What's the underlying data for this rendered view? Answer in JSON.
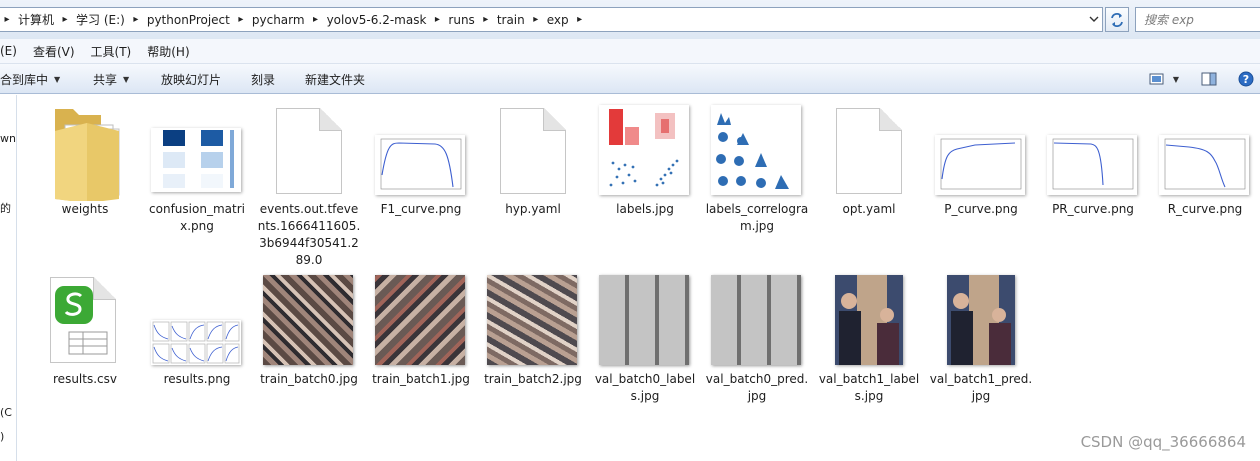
{
  "breadcrumbs": [
    "计算机",
    "学习 (E:)",
    "pythonProject",
    "pycharm",
    "yolov5-6.2-mask",
    "runs",
    "train",
    "exp"
  ],
  "search": {
    "placeholder": "搜索 exp"
  },
  "menu": [
    "(E)",
    "查看(V)",
    "工具(T)",
    "帮助(H)"
  ],
  "commands": {
    "include": "合到库中",
    "share": "共享",
    "slideshow": "放映幻灯片",
    "burn": "刻录",
    "new_folder": "新建文件夹"
  },
  "nav_fragments": [
    "wn",
    "的",
    "(C",
    ")"
  ],
  "files_row1": [
    {
      "name": "weights",
      "icon": "folder-icon"
    },
    {
      "name": "confusion_matrix.png",
      "icon": "image-icon"
    },
    {
      "name": "events.out.tfevents.1666411605.3b6944f30541.289.0",
      "icon": "file-icon"
    },
    {
      "name": "F1_curve.png",
      "icon": "image-icon"
    },
    {
      "name": "hyp.yaml",
      "icon": "file-icon"
    },
    {
      "name": "labels.jpg",
      "icon": "image-icon"
    },
    {
      "name": "labels_correlogram.jpg",
      "icon": "image-icon"
    },
    {
      "name": "opt.yaml",
      "icon": "file-icon"
    },
    {
      "name": "P_curve.png",
      "icon": "image-icon"
    },
    {
      "name": "PR_curve.png",
      "icon": "image-icon"
    },
    {
      "name": "R_curve.png",
      "icon": "image-icon"
    }
  ],
  "files_row2": [
    {
      "name": "results.csv",
      "icon": "spreadsheet-icon"
    },
    {
      "name": "results.png",
      "icon": "image-icon"
    },
    {
      "name": "train_batch0.jpg",
      "icon": "image-icon"
    },
    {
      "name": "train_batch1.jpg",
      "icon": "image-icon"
    },
    {
      "name": "train_batch2.jpg",
      "icon": "image-icon"
    },
    {
      "name": "val_batch0_labels.jpg",
      "icon": "image-icon"
    },
    {
      "name": "val_batch0_pred.jpg",
      "icon": "image-icon"
    },
    {
      "name": "val_batch1_labels.jpg",
      "icon": "image-icon"
    },
    {
      "name": "val_batch1_pred.jpg",
      "icon": "image-icon"
    }
  ],
  "watermark": "CSDN @qq_36666864",
  "colors": {
    "accent": "#3b76c4",
    "curve": "#3d5fd0",
    "csv_green": "#3ca935"
  }
}
